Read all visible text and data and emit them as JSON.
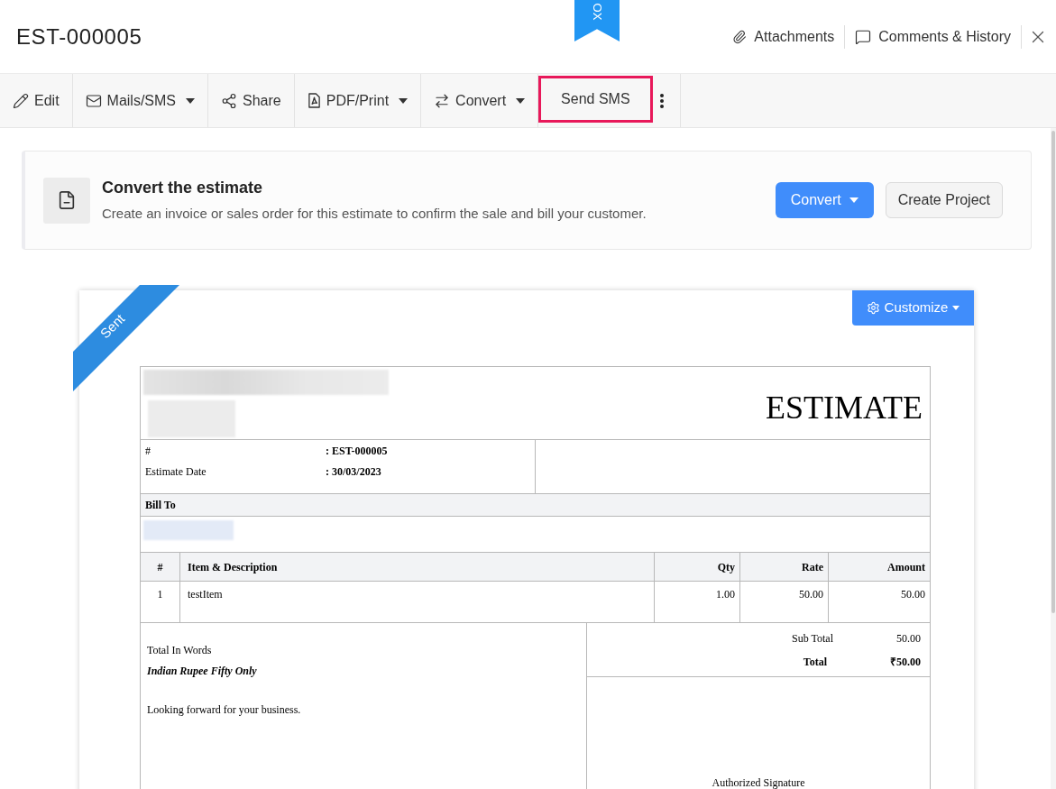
{
  "header": {
    "title": "EST-000005",
    "actions": [
      {
        "kind": "attachments",
        "label": "Attachments"
      },
      {
        "kind": "comments",
        "label": "Comments & History"
      }
    ]
  },
  "bookmark_ribbon": {
    "label": "OX"
  },
  "toolbar": [
    {
      "kind": "edit",
      "label": "Edit",
      "dropdown": false,
      "highlighted": false
    },
    {
      "kind": "mail",
      "label": "Mails/SMS",
      "dropdown": true,
      "highlighted": false
    },
    {
      "kind": "share",
      "label": "Share",
      "dropdown": false,
      "highlighted": false
    },
    {
      "kind": "pdf",
      "label": "PDF/Print",
      "dropdown": true,
      "highlighted": false
    },
    {
      "kind": "convert",
      "label": "Convert",
      "dropdown": true,
      "highlighted": false
    },
    {
      "kind": "plain",
      "label": "Send SMS",
      "dropdown": false,
      "highlighted": true
    }
  ],
  "banner": {
    "title": "Convert the estimate",
    "text": "Create an invoice or sales order for this estimate to confirm the sale and bill your customer.",
    "buttons": [
      {
        "kind": "primary",
        "label": "Convert",
        "dropdown": true
      },
      {
        "kind": "secondary",
        "label": "Create Project",
        "dropdown": false
      }
    ]
  },
  "document": {
    "status_ribbon": "Sent",
    "customize_button": "Customize",
    "heading": "ESTIMATE",
    "fields": [
      {
        "label": "#",
        "value": ": EST-000005"
      },
      {
        "label": "Estimate Date",
        "value": ": 30/03/2023"
      }
    ],
    "bill_to_label": "Bill To",
    "items": {
      "columns": [
        "#",
        "Item & Description",
        "Qty",
        "Rate",
        "Amount"
      ],
      "rows": [
        [
          "1",
          "testItem",
          "1.00",
          "50.00",
          "50.00"
        ]
      ]
    },
    "total_in_words_label": "Total In Words",
    "total_in_words": "Indian Rupee Fifty Only",
    "notes": "Looking forward for your business.",
    "totals": [
      {
        "kind": "subtotal",
        "label": "Sub Total",
        "value": "50.00"
      },
      {
        "kind": "total",
        "label": "Total",
        "value": "₹50.00"
      }
    ],
    "signature_label": "Authorized Signature"
  }
}
